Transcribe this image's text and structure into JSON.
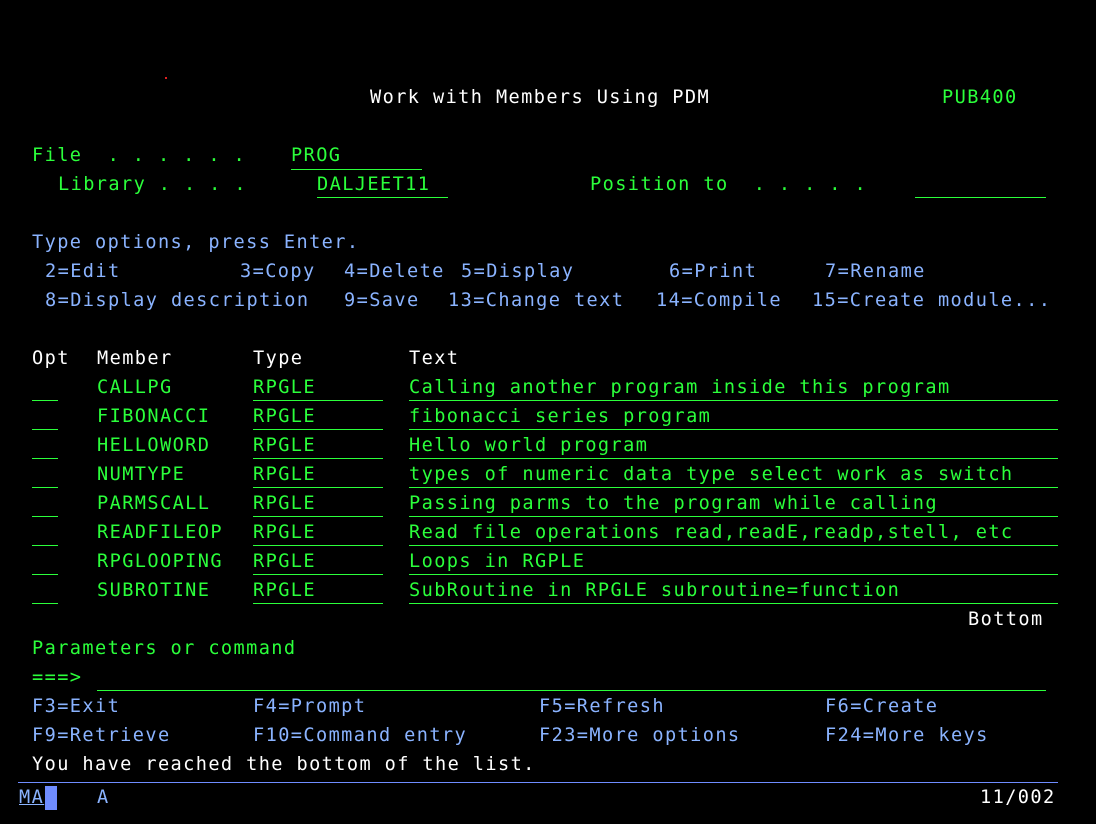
{
  "screen": {
    "title": "Work with Members Using PDM",
    "system": "PUB400"
  },
  "header": {
    "file_label": "File  . . . . . .",
    "file_value": "PROG",
    "library_label": "Library . . . .",
    "library_value": "DALJEET11",
    "position_label": "Position to  . . . . .",
    "position_value": ""
  },
  "options": {
    "prompt": "Type options, press Enter.",
    "line1": [
      {
        "text": "2=Edit"
      },
      {
        "text": "3=Copy"
      },
      {
        "text": "4=Delete"
      },
      {
        "text": "5=Display"
      },
      {
        "text": "6=Print"
      },
      {
        "text": "7=Rename"
      }
    ],
    "line2": [
      {
        "text": "8=Display description"
      },
      {
        "text": "9=Save"
      },
      {
        "text": "13=Change text"
      },
      {
        "text": "14=Compile"
      },
      {
        "text": "15=Create module..."
      }
    ]
  },
  "table": {
    "headers": {
      "opt": "Opt",
      "member": "Member",
      "type": "Type",
      "text": "Text"
    },
    "rows": [
      {
        "opt": "",
        "member": "CALLPG",
        "type": "RPGLE",
        "text": "Calling another program inside this program"
      },
      {
        "opt": "",
        "member": "FIBONACCI",
        "type": "RPGLE",
        "text": "fibonacci series program"
      },
      {
        "opt": "",
        "member": "HELLOWORD",
        "type": "RPGLE",
        "text": "Hello world program"
      },
      {
        "opt": "",
        "member": "NUMTYPE",
        "type": "RPGLE",
        "text": "types of numeric data type select work as switch"
      },
      {
        "opt": "",
        "member": "PARMSCALL",
        "type": "RPGLE",
        "text": "Passing parms to the program while calling"
      },
      {
        "opt": "",
        "member": "READFILEOP",
        "type": "RPGLE",
        "text": "Read file operations read,readE,readp,stell, etc"
      },
      {
        "opt": "",
        "member": "RPGLOOPING",
        "type": "RPGLE",
        "text": "Loops in RGPLE"
      },
      {
        "opt": "",
        "member": "SUBROTINE",
        "type": "RPGLE",
        "text": "SubRoutine in RPGLE subroutine=function"
      }
    ],
    "more_indicator": "Bottom"
  },
  "command": {
    "label": "Parameters or command",
    "arrow": "===>",
    "value": ""
  },
  "function_keys": [
    {
      "text": "F3=Exit"
    },
    {
      "text": "F4=Prompt"
    },
    {
      "text": "F5=Refresh"
    },
    {
      "text": "F6=Create"
    },
    {
      "text": "F9=Retrieve"
    },
    {
      "text": "F10=Command entry"
    },
    {
      "text": "F23=More options"
    },
    {
      "text": "F24=More keys"
    }
  ],
  "message": "You have reached the bottom of the list.",
  "status_bar": {
    "indicator": "MA",
    "mode": "A",
    "cursor_position": "11/002"
  },
  "colors": {
    "green": "#2bff3b",
    "white": "#ffffff",
    "blue": "#8ab3ff",
    "background": "#000000"
  }
}
